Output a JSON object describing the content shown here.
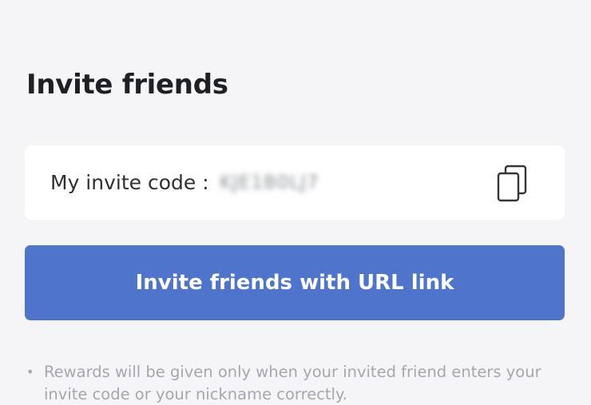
{
  "header": {
    "title": "Invite friends"
  },
  "invite_code": {
    "label": "My invite code :",
    "value": "KJE1B0LJ7",
    "copy_icon": "copy-icon"
  },
  "invite_button": {
    "label": "Invite friends with URL link",
    "color": "#4f74cc"
  },
  "notes": {
    "bullet": "•",
    "text": "Rewards will be given only when your invited friend enters your invite code or your nickname correctly."
  }
}
